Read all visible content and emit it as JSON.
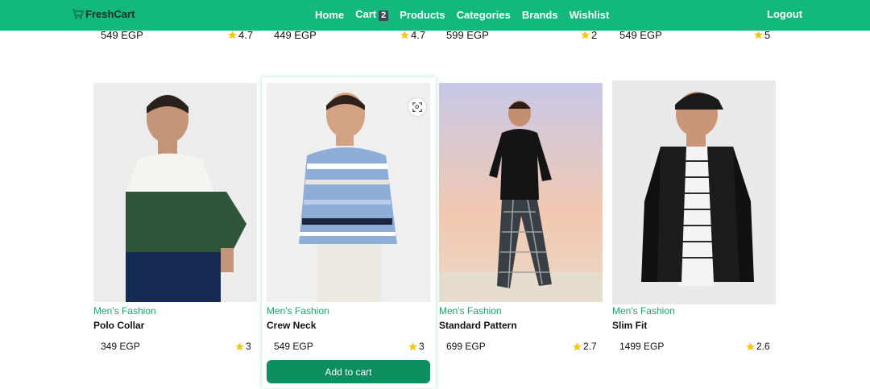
{
  "navbar": {
    "brand": "FreshCart",
    "links": [
      "Home",
      "Cart",
      "Products",
      "Categories",
      "Brands",
      "Wishlist"
    ],
    "cart_count": "2",
    "logout": "Logout",
    "accent_color": "#12b87c"
  },
  "previous_row": [
    {
      "price": "549 EGP",
      "rating": "4.7"
    },
    {
      "price": "449 EGP",
      "rating": "4.7"
    },
    {
      "price": "599 EGP",
      "rating": "2"
    },
    {
      "price": "549 EGP",
      "rating": "5"
    }
  ],
  "products": [
    {
      "category": "Men's Fashion",
      "title": "Polo Collar",
      "price": "349 EGP",
      "rating": "3"
    },
    {
      "category": "Men's Fashion",
      "title": "Crew Neck",
      "price": "549 EGP",
      "rating": "3",
      "action": "Add to cart"
    },
    {
      "category": "Men's Fashion",
      "title": "Standard Pattern",
      "price": "699 EGP",
      "rating": "2.7"
    },
    {
      "category": "Men's Fashion",
      "title": "Slim Fit",
      "price": "1499 EGP",
      "rating": "2.6"
    }
  ],
  "icons": {
    "star": "star-icon",
    "zoom": "zoom-scan-icon",
    "brand": "cart-icon"
  }
}
